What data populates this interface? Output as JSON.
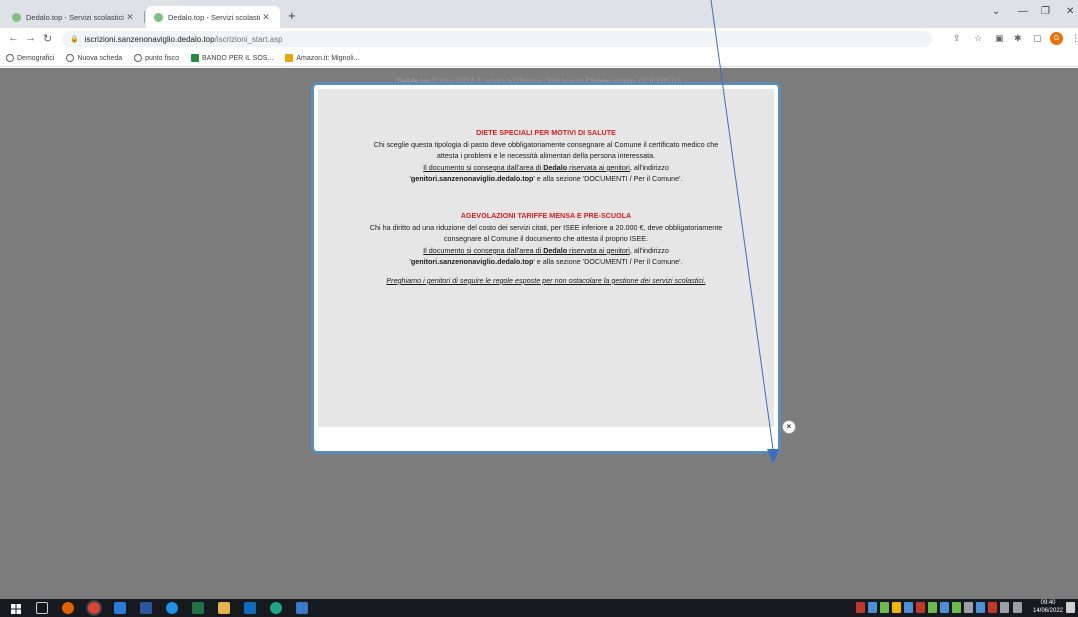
{
  "browser": {
    "tabs": [
      {
        "title": "Dedalo.top - Servizi scolastici",
        "active": false
      },
      {
        "title": "Dedalo.top - Servizi scolastici",
        "active": true
      }
    ],
    "url_host": "iscrizioni.sanzenonaviglio.dedalo.top",
    "url_path": "/iscrizioni_start.asp",
    "profile_initial": "G",
    "bookmarks": [
      "Demografici",
      "Nuova scheda",
      "punto fisco",
      "BANDO PER IL SOS...",
      "Amazon.it: Mignoli..."
    ]
  },
  "page": {
    "credits": {
      "brand": "Dedalo.top",
      "text": " © 2016-2022 A.T. Service Srl (Verona) · Web browser ",
      "browser_name": "Chrome",
      "version_text": " versione 102.0.5005.115"
    }
  },
  "modal": {
    "section1": {
      "title": "DIETE SPECIALI PER MOTIVI DI SALUTE",
      "line1": "Chi sceglie questa tipologia di pasto deve obbligatoriamente consegnare al Comune il certificato medico che",
      "line2": "attesta i problemi e le necessità alimentari della persona interessata.",
      "doc_a": "Il documento si consegna dall'area di ",
      "doc_b": "Dedalo",
      "doc_c": " riservata ai genitori",
      "doc_d": ", all'indirizzo",
      "addr_a": "'",
      "addr_b": "genitori.sanzenonaviglio.dedalo.top",
      "addr_c": "' e alla sezione 'DOCUMENTI / Per il Comune'."
    },
    "section2": {
      "title": "AGEVOLAZIONI TARIFFE MENSA E PRE-SCUOLA",
      "line1": "Chi ha diritto ad una riduzione del costo dei servizi citati, per ISEE inferiore a 20.000 €, deve obbligatoriamente",
      "line2": "consegnare al Comune il documento che attesta il proprio ISEE.",
      "doc_a": "Il documento si consegna dall'area di ",
      "doc_b": "Dedalo",
      "doc_c": " riservata ai genitori",
      "doc_d": ", all'indirizzo",
      "addr_a": "'",
      "addr_b": "genitori.sanzenonaviglio.dedalo.top",
      "addr_c": "' e alla sezione 'DOCUMENTI / Per il Comune'."
    },
    "note": "Preghiamo i genitori di seguire le regole esposte per non ostacolare la gestione dei servizi scolastici.",
    "close_label": "×"
  },
  "taskbar": {
    "time": "09:40",
    "date": "14/06/2022"
  },
  "colors": {
    "accent_red": "#d81e1e",
    "modal_border": "#5b8db8",
    "annotation_arrow": "#3a6fbf"
  }
}
